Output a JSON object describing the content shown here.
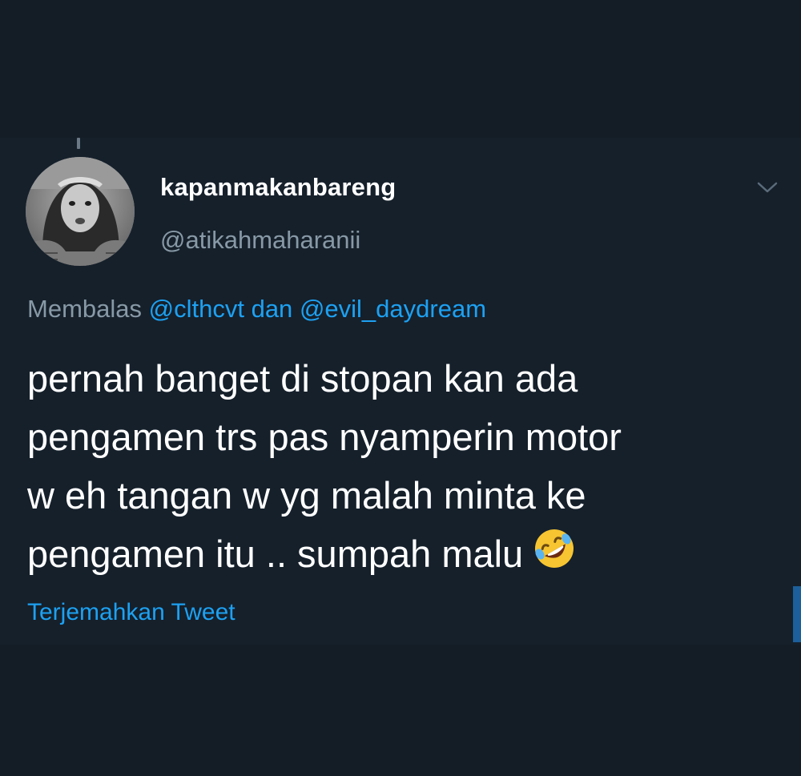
{
  "tweet": {
    "display_name": "kapanmakanbareng",
    "handle": "@atikahmaharanii",
    "reply_prefix": "Membalas",
    "reply_mention_1": "@clthcvt",
    "reply_conjunction": "dan",
    "reply_mention_2": "@evil_daydream",
    "text": "pernah banget di stopan kan ada\npengamen trs pas nyamperin motor\nw eh tangan w yg malah minta ke\npengamen itu .. sumpah malu",
    "emoji": "rolling-on-the-floor-laughing-emoji",
    "translate_label": "Terjemahkan Tweet"
  },
  "colors": {
    "background": "#15202b",
    "text_primary": "#ffffff",
    "text_secondary": "#8899a6",
    "accent": "#1da1f2"
  },
  "icons": {
    "menu": "chevron-down-icon"
  }
}
